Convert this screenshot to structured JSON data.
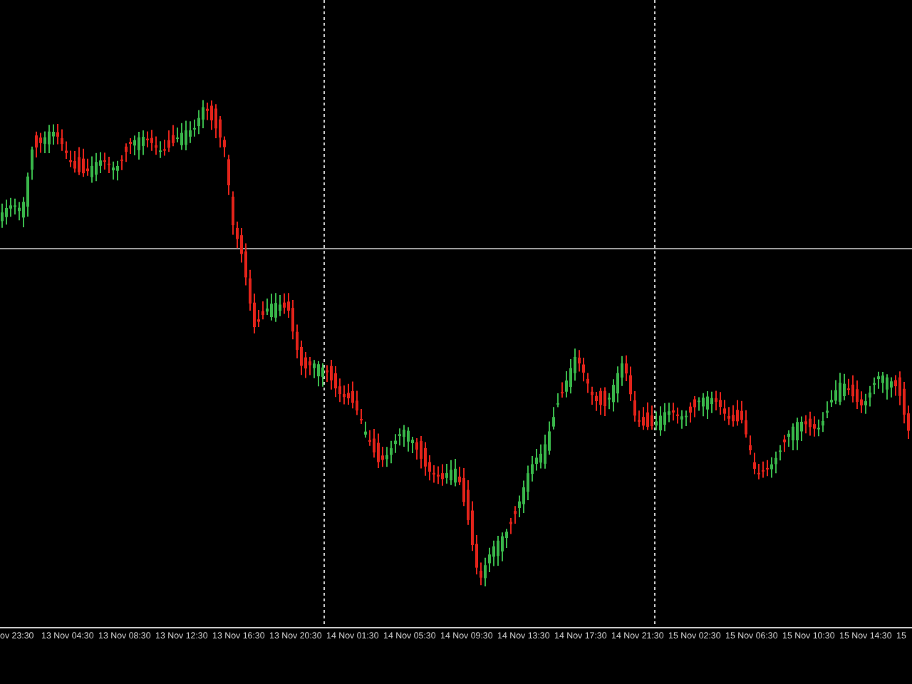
{
  "chart": {
    "kind": "candlestick"
  },
  "time_axis": {
    "labels": [
      "ov 23:30",
      "13 Nov 04:30",
      "13 Nov 08:30",
      "13 Nov 12:30",
      "13 Nov 16:30",
      "13 Nov 20:30",
      "14 Nov 01:30",
      "14 Nov 05:30",
      "14 Nov 09:30",
      "14 Nov 13:30",
      "14 Nov 17:30",
      "14 Nov 21:30",
      "15 Nov 02:30",
      "15 Nov 06:30",
      "15 Nov 10:30",
      "15 Nov 14:30",
      "15"
    ]
  }
}
